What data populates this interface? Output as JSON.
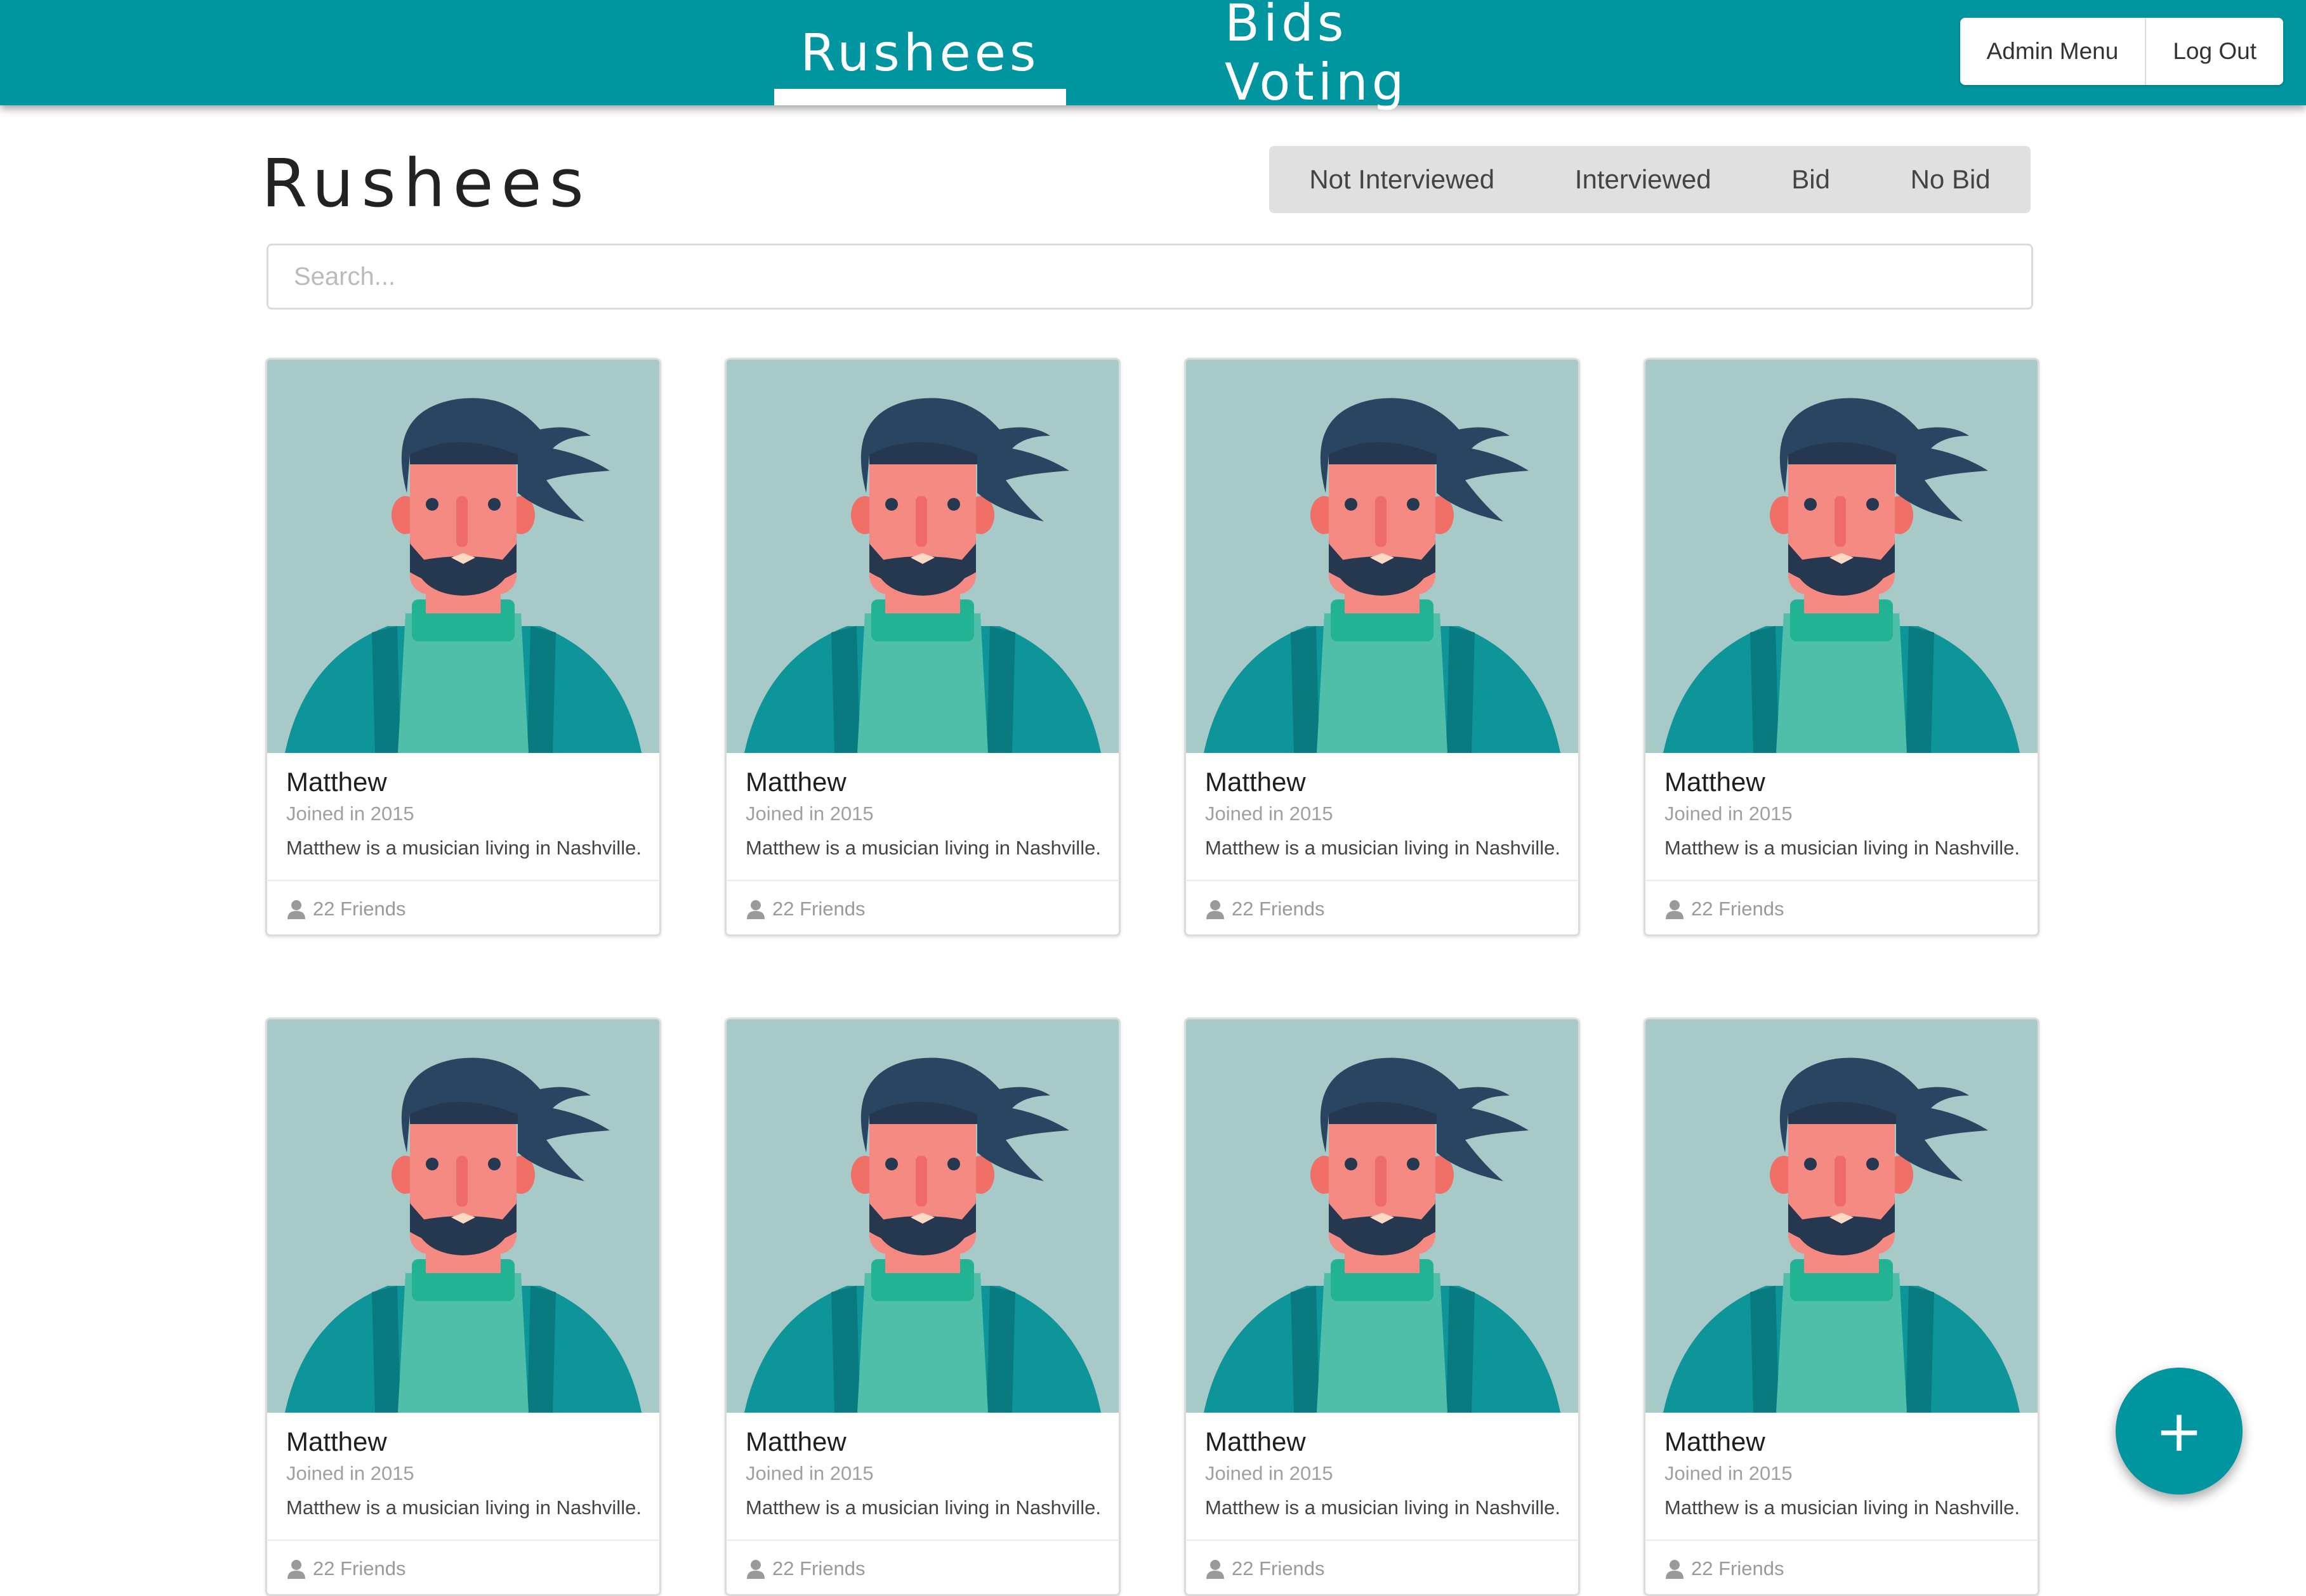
{
  "nav": {
    "tabs": [
      {
        "label": "Rushees",
        "active": true
      },
      {
        "label": "Bids Voting",
        "active": false
      }
    ],
    "admin_menu_label": "Admin Menu",
    "logout_label": "Log Out"
  },
  "page": {
    "title": "Rushees",
    "filters": [
      "Not Interviewed",
      "Interviewed",
      "Bid",
      "No Bid"
    ],
    "search_placeholder": "Search..."
  },
  "cards": [
    {
      "name": "Matthew",
      "joined": "Joined in 2015",
      "description": "Matthew is a musician living in Nashville.",
      "friends": "22 Friends"
    },
    {
      "name": "Matthew",
      "joined": "Joined in 2015",
      "description": "Matthew is a musician living in Nashville.",
      "friends": "22 Friends"
    },
    {
      "name": "Matthew",
      "joined": "Joined in 2015",
      "description": "Matthew is a musician living in Nashville.",
      "friends": "22 Friends"
    },
    {
      "name": "Matthew",
      "joined": "Joined in 2015",
      "description": "Matthew is a musician living in Nashville.",
      "friends": "22 Friends"
    },
    {
      "name": "Matthew",
      "joined": "Joined in 2015",
      "description": "Matthew is a musician living in Nashville.",
      "friends": "22 Friends"
    },
    {
      "name": "Matthew",
      "joined": "Joined in 2015",
      "description": "Matthew is a musician living in Nashville.",
      "friends": "22 Friends"
    },
    {
      "name": "Matthew",
      "joined": "Joined in 2015",
      "description": "Matthew is a musician living in Nashville.",
      "friends": "22 Friends"
    },
    {
      "name": "Matthew",
      "joined": "Joined in 2015",
      "description": "Matthew is a musician living in Nashville.",
      "friends": "22 Friends"
    }
  ],
  "fab": {
    "icon": "plus-icon",
    "label": "+"
  },
  "colors": {
    "primary": "#00959f",
    "card_image_bg": "#a7c9c8",
    "filter_bg": "#e0e0e0"
  }
}
